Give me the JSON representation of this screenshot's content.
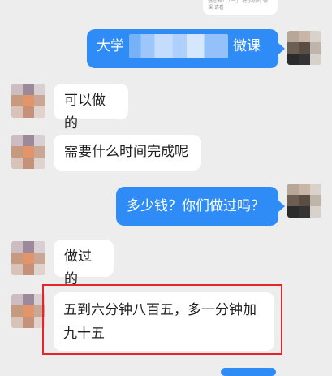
{
  "top_card": {
    "text": "选您格! 「一」 托尔加的 微课 请看"
  },
  "messages": [
    {
      "id": "m1",
      "side": "out",
      "text_before": "大学",
      "text_after": "微课",
      "has_blur": true
    },
    {
      "id": "m2",
      "side": "in",
      "text": "可以做的"
    },
    {
      "id": "m3",
      "side": "in",
      "text": "需要什么时间完成呢"
    },
    {
      "id": "m4",
      "side": "out",
      "text": "多少钱？你们做过吗？"
    },
    {
      "id": "m5",
      "side": "in",
      "text": "做过的"
    },
    {
      "id": "m6",
      "side": "in",
      "line1": "五到六分钟八百五，多一分钟加",
      "line2": "九十五",
      "highlighted": true
    }
  ],
  "colors": {
    "background": "#ededed",
    "outgoing_bubble": "#2f8cf6",
    "incoming_bubble": "#ffffff",
    "highlight_border": "#e3262a"
  }
}
